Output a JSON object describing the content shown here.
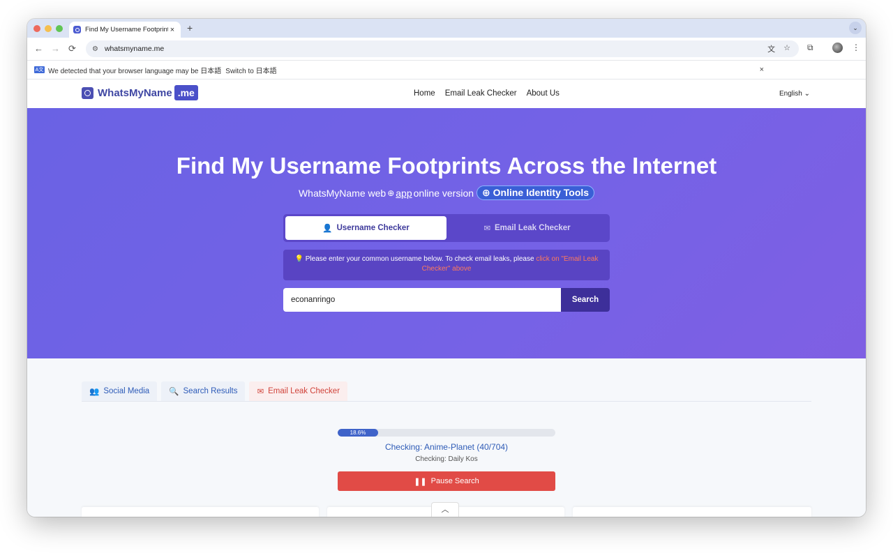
{
  "browser": {
    "tab_title": "Find My Username Footprints",
    "tab_close": "×",
    "new_tab": "+",
    "tabs_menu": "⌄",
    "back": "←",
    "forward": "→",
    "reload": "⟳",
    "url": "whatsmyname.me",
    "menu": "⋮"
  },
  "infobar": {
    "lang_icon": "A文",
    "message": "We detected that your browser language may be 日本語",
    "switch_label": "Switch to 日本語",
    "close": "×"
  },
  "site": {
    "logo_text": "WhatsMyName",
    "logo_badge": ".me",
    "nav": [
      "Home",
      "Email Leak Checker",
      "About Us"
    ],
    "language": "English"
  },
  "hero": {
    "title": "Find My Username Footprints Across the Internet",
    "subtitle_prefix": "WhatsMyName web",
    "subtitle_app": "app",
    "subtitle_suffix": "online version",
    "identity_button": "Online Identity Tools",
    "tabs": {
      "username": "Username Checker",
      "email": "Email Leak Checker"
    },
    "hint_text": "Please enter your common username below. To check email leaks, please",
    "hint_link": "click on \"Email Leak Checker\" above",
    "search_value": "econanringo",
    "search_button": "Search"
  },
  "results": {
    "tabs": {
      "social": "Social Media",
      "search": "Search Results",
      "email": "Email Leak Checker"
    },
    "progress_label": "18.6%",
    "progress_fraction": 0.186,
    "checking_main": "Checking: Anime-Planet (40/704)",
    "checking_sub": "Checking: Daily Kos",
    "pause_button": "Pause Search"
  },
  "colors": {
    "hero_gradient_start": "#6a62e4",
    "hero_gradient_end": "#7f5fe3",
    "brand": "#4b50c9",
    "pause_red": "#e14b46",
    "progress_blue": "#3f63c9",
    "hint_link": "#ff7a5c"
  },
  "icons": {
    "tab_favicon": "magnifier-logo-icon",
    "site_info": "tune-icon",
    "translate": "translate-icon",
    "bookmark": "star-icon",
    "extensions": "puzzle-icon",
    "user": "user-icon",
    "mail": "envelope-icon",
    "lightbulb": "lightbulb-icon",
    "users": "users-icon",
    "search": "search-icon",
    "pause": "pause-icon",
    "chevron_up": "chevron-up-icon"
  }
}
